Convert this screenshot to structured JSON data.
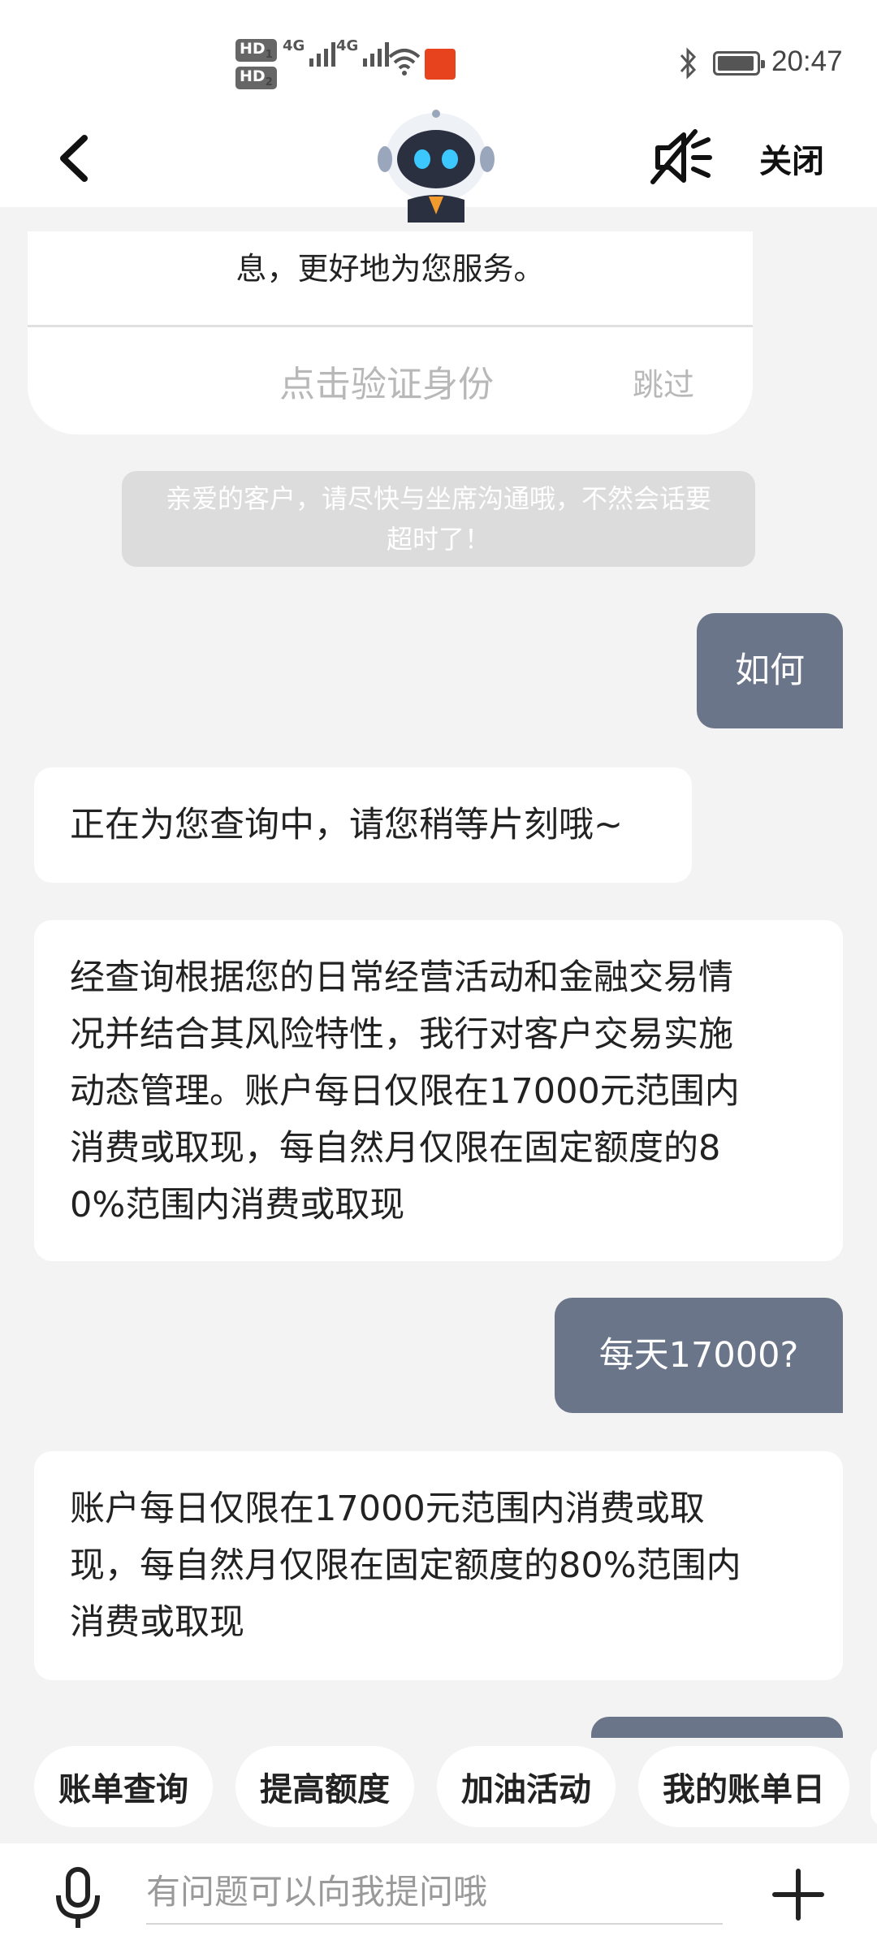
{
  "status_bar": {
    "time": "20:47",
    "network1": "4G",
    "network2": "4G",
    "hd1": "HD",
    "hd1_sub": "1",
    "hd2": "HD",
    "hd2_sub": "2",
    "icons": [
      "signal-icon",
      "wifi-icon",
      "app-badge-icon",
      "bluetooth-icon",
      "battery-icon"
    ]
  },
  "nav": {
    "close_label": "关闭",
    "icons": [
      "back-icon",
      "robot-avatar",
      "mute-icon"
    ]
  },
  "verify_card": {
    "text_tail": "息，更好地为您服务。",
    "verify_label": "点击验证身份",
    "skip_label": "跳过"
  },
  "system_notice": {
    "line1": "亲爱的客户，请尽快与坐席沟通哦，不然会话要",
    "line2": "超时了！"
  },
  "messages": [
    {
      "from": "user",
      "text": "如何"
    },
    {
      "from": "bot",
      "text": "正在为您查询中，请您稍等片刻哦~"
    },
    {
      "from": "bot",
      "lines": [
        "经查询根据您的日常经营活动和金融交易情",
        "况并结合其风险特性，我行对客户交易实施",
        "动态管理。账户每日仅限在17000元范围内",
        "消费或取现，每自然月仅限在固定额度的8",
        "0%范围内消费或取现"
      ]
    },
    {
      "from": "user",
      "text": "每天17000?"
    },
    {
      "from": "bot",
      "lines": [
        "账户每日仅限在17000元范围内消费或取",
        "现，每自然月仅限在固定额度的80%范围内",
        "消费或取现"
      ]
    }
  ],
  "quick_chips": [
    "账单查询",
    "提高额度",
    "加油活动",
    "我的账单日"
  ],
  "input_bar": {
    "placeholder": "有问题可以向我提问哦",
    "icons": [
      "microphone-icon",
      "plus-icon"
    ]
  },
  "colors": {
    "user_bubble": "#6b7589",
    "background": "#f3f3f3",
    "notice_bg": "#dcdcdc"
  }
}
